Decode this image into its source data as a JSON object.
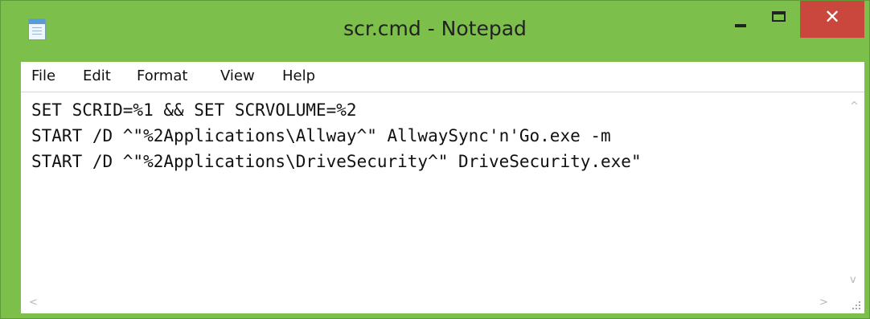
{
  "window": {
    "title": "scr.cmd - Notepad",
    "close_glyph": "✕",
    "icons": {
      "app": "notepad-icon",
      "minimize": "minimize-icon",
      "maximize": "maximize-icon",
      "close": "close-icon"
    },
    "colors": {
      "frame": "#7cbf4b",
      "close": "#c9473d"
    }
  },
  "menu": {
    "items": [
      {
        "label": "File"
      },
      {
        "label": "Edit"
      },
      {
        "label": "Format"
      },
      {
        "label": "View"
      },
      {
        "label": "Help"
      }
    ]
  },
  "editor": {
    "lines": [
      "SET SCRID=%1 && SET SCRVOLUME=%2",
      "START /D ^\"%2Applications\\Allway^\" AllwaySync'n'Go.exe -m",
      "START /D ^\"%2Applications\\DriveSecurity^\" DriveSecurity.exe\""
    ]
  },
  "scrollbars": {
    "up_glyph": "^",
    "down_glyph": "v",
    "left_glyph": "<",
    "right_glyph": ">"
  }
}
